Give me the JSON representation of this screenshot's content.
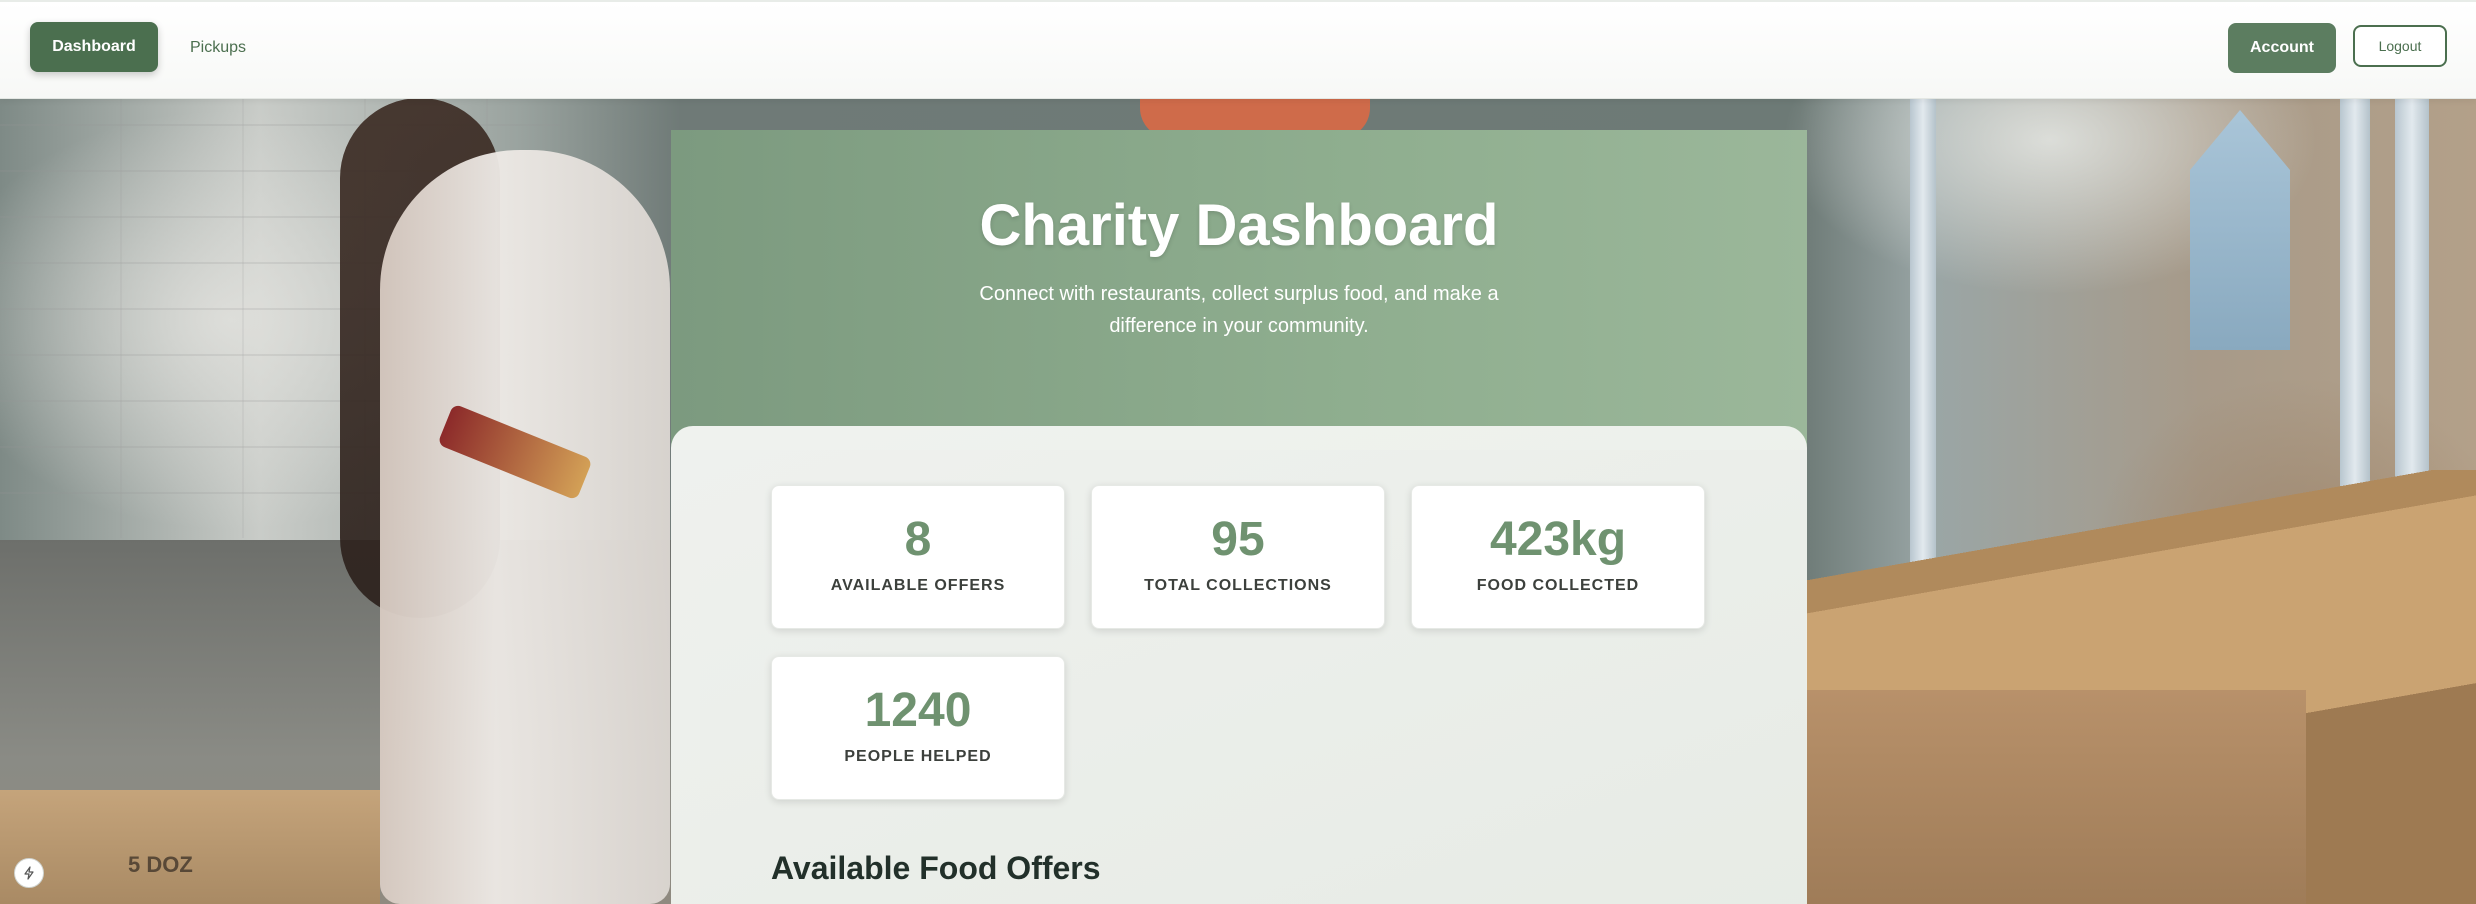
{
  "nav": {
    "dashboard_label": "Dashboard",
    "pickups_label": "Pickups",
    "account_label": "Account",
    "logout_label": "Logout"
  },
  "hero": {
    "title": "Charity Dashboard",
    "subtitle": "Connect with restaurants, collect surplus food, and make a difference in your community."
  },
  "stats": [
    {
      "value": "8",
      "label": "AVAILABLE OFFERS"
    },
    {
      "value": "95",
      "label": "TOTAL COLLECTIONS"
    },
    {
      "value": "423kg",
      "label": "FOOD COLLECTED"
    },
    {
      "value": "1240",
      "label": "PEOPLE HELPED"
    }
  ],
  "offers_section": {
    "title": "Available Food Offers"
  },
  "background": {
    "box_label": "5 DOZ"
  },
  "colors": {
    "accent": "#4b6f4f",
    "hero_green": "#8fae8f",
    "stat_value": "#6f9270"
  },
  "icons": {
    "corner_badge": "bolt-icon"
  }
}
